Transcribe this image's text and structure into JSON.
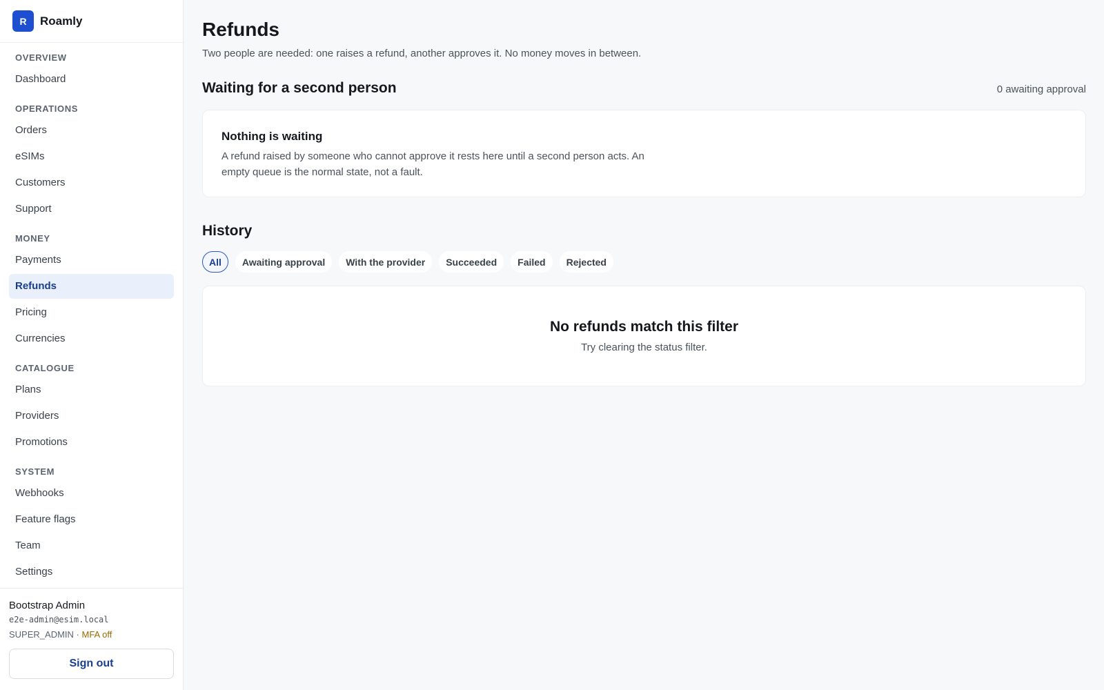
{
  "brand": {
    "initial": "R",
    "name": "Roamly"
  },
  "sidebar": {
    "sections": [
      {
        "title": "OVERVIEW",
        "items": [
          "Dashboard"
        ]
      },
      {
        "title": "OPERATIONS",
        "items": [
          "Orders",
          "eSIMs",
          "Customers",
          "Support"
        ]
      },
      {
        "title": "MONEY",
        "items": [
          "Payments",
          "Refunds",
          "Pricing",
          "Currencies"
        ]
      },
      {
        "title": "CATALOGUE",
        "items": [
          "Plans",
          "Providers",
          "Promotions"
        ]
      },
      {
        "title": "SYSTEM",
        "items": [
          "Webhooks",
          "Feature flags",
          "Team",
          "Settings"
        ]
      }
    ],
    "active_item": "Refunds"
  },
  "user": {
    "name": "Bootstrap Admin",
    "email": "e2e-admin@esim.local",
    "role": "SUPER_ADMIN",
    "separator": " · ",
    "mfa": "MFA off",
    "sign_out_label": "Sign out"
  },
  "page": {
    "title": "Refunds",
    "subtitle": "Two people are needed: one raises a refund, another approves it. No money moves in between."
  },
  "waiting": {
    "title": "Waiting for a second person",
    "count_text": "0 awaiting approval",
    "empty_title": "Nothing is waiting",
    "empty_body": "A refund raised by someone who cannot approve it rests here until a second person acts. An empty queue is the normal state, not a fault."
  },
  "history": {
    "title": "History",
    "filters": [
      "All",
      "Awaiting approval",
      "With the provider",
      "Succeeded",
      "Failed",
      "Rejected"
    ],
    "active_filter": "All",
    "empty_title": "No refunds match this filter",
    "empty_body": "Try clearing the status filter."
  }
}
